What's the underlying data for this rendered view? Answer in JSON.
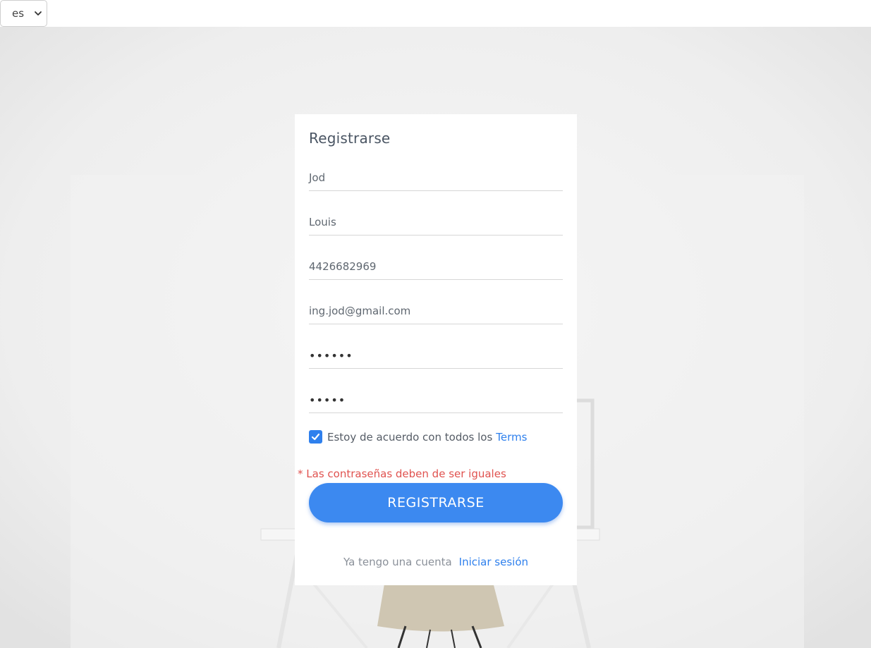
{
  "language_select": {
    "value": "es"
  },
  "form": {
    "title": "Registrarse",
    "first_name": "Jod",
    "last_name": "Louis",
    "phone": "4426682969",
    "email": "ing.jod@gmail.com",
    "password_mask": "••••••",
    "confirm_password_mask": "•••••",
    "terms_text": "Estoy de acuerdo con todos los",
    "terms_link": "Terms",
    "terms_checked": true,
    "error": "* Las contraseñas deben de ser iguales",
    "submit_label": "REGISTRARSE",
    "have_account_text": "Ya tengo una cuenta",
    "login_link": "Iniciar sesión"
  },
  "colors": {
    "accent": "#3c89f0",
    "link": "#2f80ed",
    "error": "#e0524f",
    "background": "#ececec"
  }
}
